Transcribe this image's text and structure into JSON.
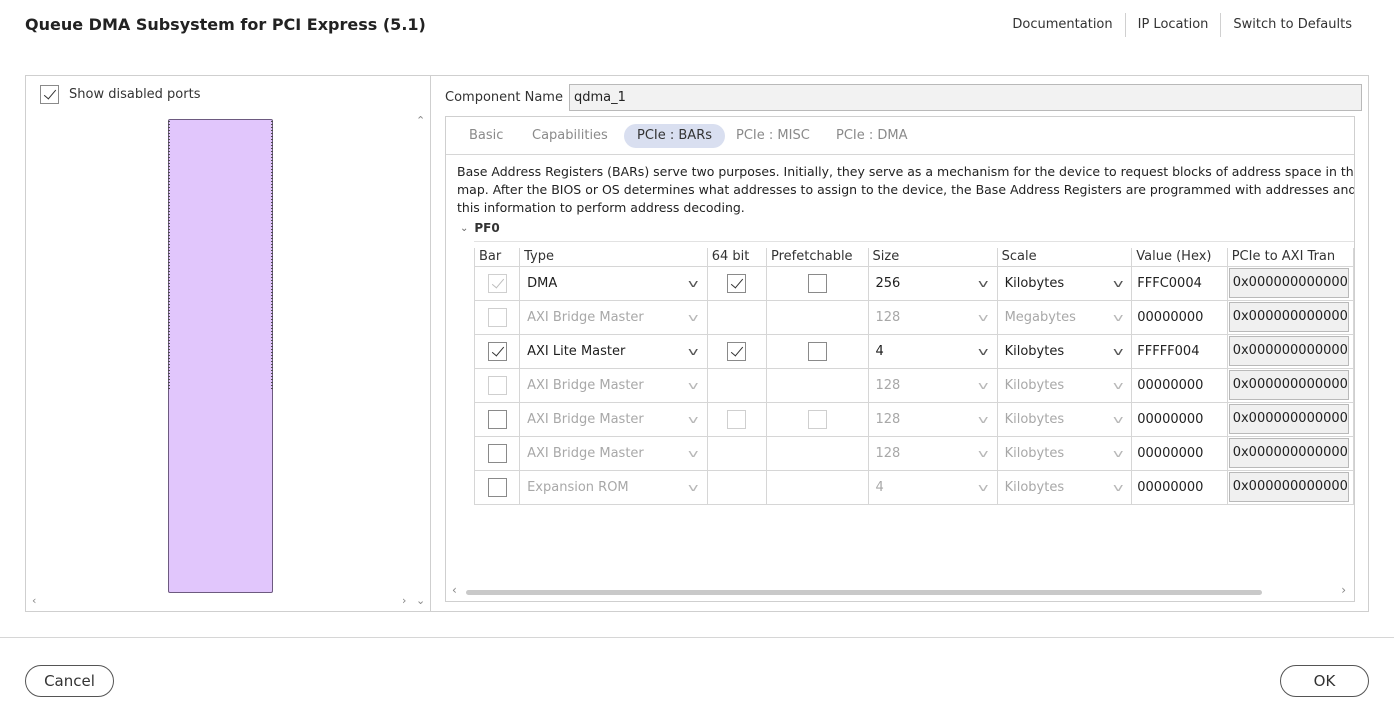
{
  "header": {
    "title": "Queue DMA Subsystem for PCI Express (5.1)",
    "links": [
      "Documentation",
      "IP Location",
      "Switch to Defaults"
    ]
  },
  "left_pane": {
    "show_disabled_ports_label": "Show disabled ports",
    "show_disabled_ports_checked": true,
    "block_color": "#e1c6fc"
  },
  "component": {
    "label": "Component Name",
    "value": "qdma_1"
  },
  "tabs": [
    {
      "label": "Basic",
      "active": false
    },
    {
      "label": "Capabilities",
      "active": false
    },
    {
      "label": "PCIe : BARs",
      "active": true
    },
    {
      "label": "PCIe : MISC",
      "active": false
    },
    {
      "label": "PCIe : DMA",
      "active": false
    }
  ],
  "description": [
    "Base Address Registers (BARs) serve two purposes. Initially, they serve as a mechanism for the device to request blocks of address space in the system m",
    "map. After the BIOS or OS determines what addresses to assign to the device, the Base Address Registers are programmed with addresses and the devic",
    "this information to perform address decoding."
  ],
  "section": {
    "label": "PF0"
  },
  "table": {
    "headers": [
      "Bar",
      "Type",
      "64 bit",
      "Prefetchable",
      "Size",
      "Scale",
      "Value (Hex)",
      "PCIe to AXI Tran"
    ],
    "rows": [
      {
        "bar_checked": true,
        "bar_disabled": true,
        "type": "DMA",
        "row_disabled": false,
        "bit64": "checked",
        "prefetch": "unchecked",
        "size": "256",
        "scale": "Kilobytes",
        "value": "FFFC0004",
        "pcie_to_axi": "0x000000000000"
      },
      {
        "bar_checked": false,
        "bar_disabled": true,
        "type": "AXI Bridge Master",
        "row_disabled": true,
        "bit64": "none",
        "prefetch": "none",
        "size": "128",
        "scale": "Megabytes",
        "value": "00000000",
        "pcie_to_axi": "0x000000000000"
      },
      {
        "bar_checked": true,
        "bar_disabled": false,
        "type": "AXI Lite Master",
        "row_disabled": false,
        "bit64": "checked",
        "prefetch": "unchecked",
        "size": "4",
        "scale": "Kilobytes",
        "value": "FFFFF004",
        "pcie_to_axi": "0x000000000000"
      },
      {
        "bar_checked": false,
        "bar_disabled": true,
        "type": "AXI Bridge Master",
        "row_disabled": true,
        "bit64": "none",
        "prefetch": "none",
        "size": "128",
        "scale": "Kilobytes",
        "value": "00000000",
        "pcie_to_axi": "0x000000000000"
      },
      {
        "bar_checked": false,
        "bar_disabled": false,
        "type": "AXI Bridge Master",
        "row_disabled": true,
        "bit64": "disabled",
        "prefetch": "disabled",
        "size": "128",
        "scale": "Kilobytes",
        "value": "00000000",
        "pcie_to_axi": "0x000000000000"
      },
      {
        "bar_checked": false,
        "bar_disabled": false,
        "type": "AXI Bridge Master",
        "row_disabled": true,
        "bit64": "none",
        "prefetch": "none",
        "size": "128",
        "scale": "Kilobytes",
        "value": "00000000",
        "pcie_to_axi": "0x000000000000"
      },
      {
        "bar_checked": false,
        "bar_disabled": false,
        "type": "Expansion ROM",
        "row_disabled": true,
        "bit64": "none",
        "prefetch": "none",
        "size": "4",
        "scale": "Kilobytes",
        "value": "00000000",
        "pcie_to_axi": "0x000000000000"
      }
    ]
  },
  "footer": {
    "cancel_label": "Cancel",
    "ok_label": "OK"
  }
}
